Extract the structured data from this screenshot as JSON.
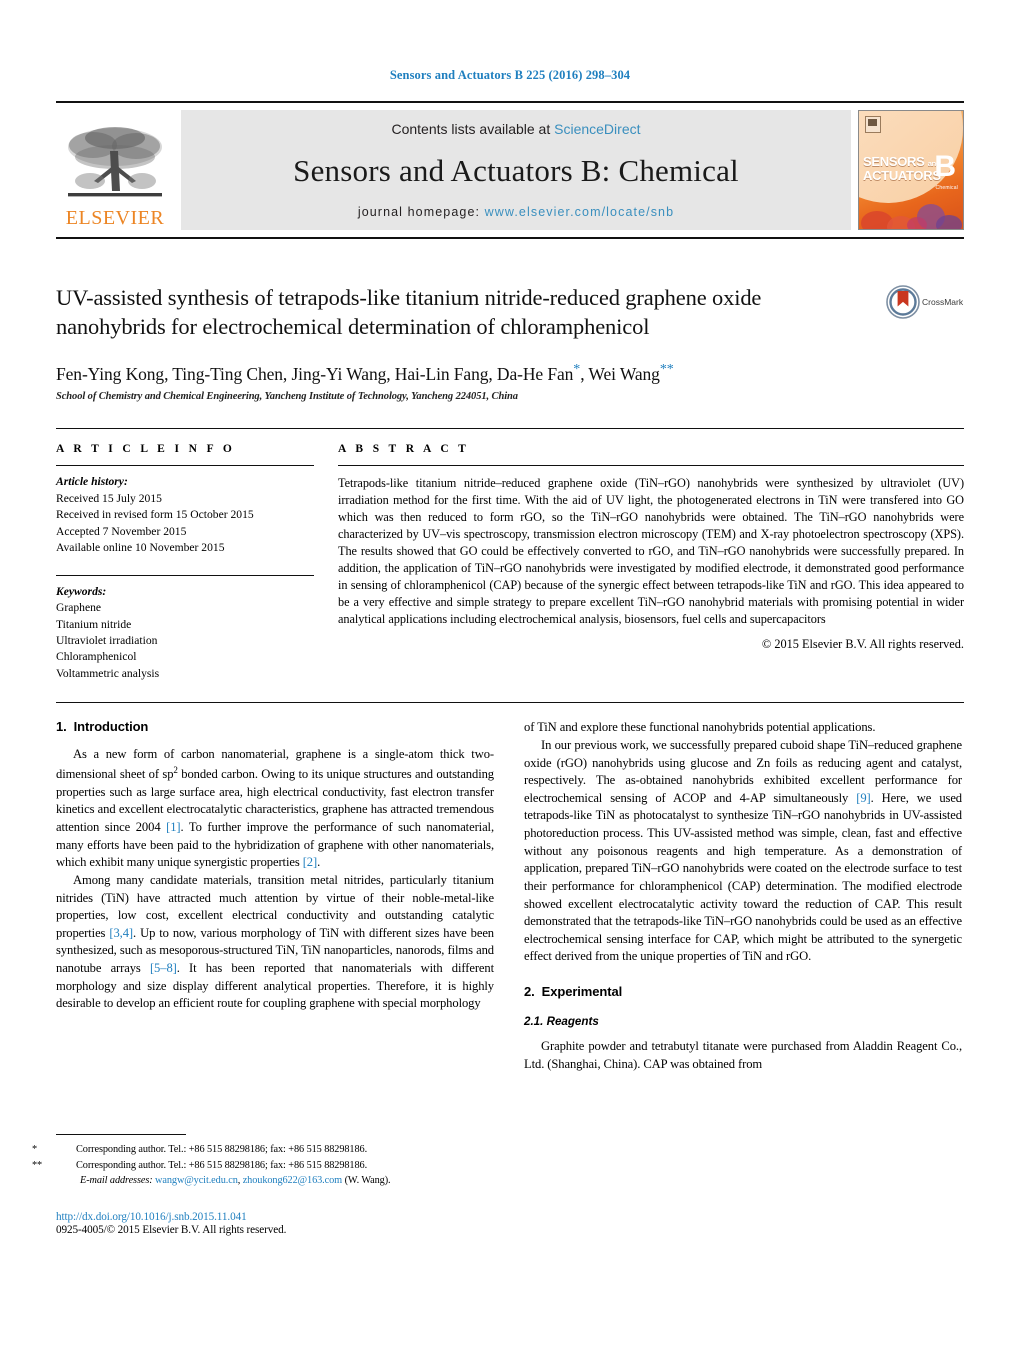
{
  "running_head": "Sensors and Actuators B 225 (2016) 298–304",
  "masthead": {
    "publisher_wordmark": "ELSEVIER",
    "contents_prefix": "Contents lists available at ",
    "contents_link": "ScienceDirect",
    "journal_title": "Sensors and Actuators B: Chemical",
    "homepage_prefix": "journal homepage: ",
    "homepage_url": "www.elsevier.com/locate/snb",
    "cover": {
      "line1": "SENSORS",
      "line1_and": "and",
      "line2": "ACTUATORS",
      "letter": "B",
      "letter_sub": "Chemical"
    }
  },
  "article": {
    "title": "UV-assisted synthesis of tetrapods-like titanium nitride-reduced graphene oxide nanohybrids for electrochemical determination of chloramphenicol",
    "crossmark_label": "CrossMark",
    "authors": "Fen-Ying Kong, Ting-Ting Chen, Jing-Yi Wang, Hai-Lin Fang, Da-He Fan",
    "authors_tail": ", Wei Wang",
    "star1": "*",
    "star2": "**",
    "affiliation": "School of Chemistry and Chemical Engineering, Yancheng Institute of Technology, Yancheng 224051, China"
  },
  "article_info": {
    "heading": "A R T I C L E   I N F O",
    "history_label": "Article history:",
    "history": [
      "Received 15 July 2015",
      "Received in revised form 15 October 2015",
      "Accepted 7 November 2015",
      "Available online 10 November 2015"
    ],
    "keywords_label": "Keywords:",
    "keywords": [
      "Graphene",
      "Titanium nitride",
      "Ultraviolet irradiation",
      "Chloramphenicol",
      "Voltammetric analysis"
    ]
  },
  "abstract": {
    "heading": "A B S T R A C T",
    "text": "Tetrapods-like titanium nitride–reduced graphene oxide (TiN–rGO) nanohybrids were synthesized by ultraviolet (UV) irradiation method for the first time. With the aid of UV light, the photogenerated electrons in TiN were transfered into GO which was then reduced to form rGO, so the TiN–rGO nanohybrids were obtained. The TiN–rGO nanohybrids were characterized by UV–vis spectroscopy, transmission electron microscopy (TEM) and X-ray photoelectron spectroscopy (XPS). The results showed that GO could be effectively converted to rGO, and TiN–rGO nanohybrids were successfully prepared. In addition, the application of TiN–rGO nanohybrids were investigated by modified electrode, it demonstrated good performance in sensing of chloramphenicol (CAP) because of the synergic effect between tetrapods-like TiN and rGO. This idea appeared to be a very effective and simple strategy to prepare excellent TiN–rGO nanohybrid materials with promising potential in wider analytical applications including electrochemical analysis, biosensors, fuel cells and supercapacitors",
    "copyright": "© 2015 Elsevier B.V. All rights reserved."
  },
  "sections": {
    "intro_number": "1.",
    "intro_title": "Introduction",
    "experimental_number": "2.",
    "experimental_title": "Experimental",
    "reagents_number": "2.1.",
    "reagents_title": "Reagents"
  },
  "body": {
    "left_p1_a": "As a new form of carbon nanomaterial, graphene is a single-atom thick two-dimensional sheet of sp",
    "left_p1_sup": "2",
    "left_p1_b": " bonded carbon. Owing to its unique structures and outstanding properties such as large surface area, high electrical conductivity, fast electron transfer kinetics and excellent electrocatalytic characteristics, graphene has attracted tremendous attention since 2004 ",
    "left_p1_ref1": "[1]",
    "left_p1_c": ". To further improve the performance of such nanomaterial, many efforts have been paid to the hybridization of graphene with other nanomaterials, which exhibit many unique synergistic properties ",
    "left_p1_ref2": "[2]",
    "left_p1_d": ".",
    "left_p2_a": "Among many candidate materials, transition metal nitrides, particularly titanium nitrides (TiN) have attracted much attention by virtue of their noble-metal-like properties, low cost, excellent electrical conductivity and outstanding catalytic properties ",
    "left_p2_ref1": "[3,4]",
    "left_p2_b": ". Up to now, various morphology of TiN with different sizes have been synthesized, such as mesoporous-structured TiN, TiN nanoparticles, nanorods, films and nanotube arrays ",
    "left_p2_ref2": "[5–8]",
    "left_p2_c": ". It has been reported that nanomaterials with different morphology and size display different analytical properties. Therefore, it is highly desirable to develop an efficient route for coupling graphene with special morphology",
    "right_p0": "of TiN and explore these functional nanohybrids potential applications.",
    "right_p1_a": "In our previous work, we successfully prepared cuboid shape TiN–reduced graphene oxide (rGO) nanohybrids using glucose and Zn foils as reducing agent and catalyst, respectively. The as-obtained nanohybrids exhibited excellent performance for electrochemical sensing of ACOP and 4-AP simultaneously ",
    "right_p1_ref": "[9]",
    "right_p1_b": ". Here, we used tetrapods-like TiN as photocatalyst to synthesize TiN–rGO nanohybrids in UV-assisted photoreduction process. This UV-assisted method was simple, clean, fast and effective without any poisonous reagents and high temperature. As a demonstration of application, prepared TiN–rGO nanohybrids were coated on the electrode surface to test their performance for chloramphenicol (CAP) determination. The modified electrode showed excellent electrocatalytic activity toward the reduction of CAP. This result demonstrated that the tetrapods-like TiN–rGO nanohybrids could be used as an effective electrochemical sensing interface for CAP, which might be attributed to the synergetic effect derived from the unique properties of TiN and rGO.",
    "reagents_p1": "Graphite powder and tetrabutyl titanate were purchased from Aladdin Reagent Co., Ltd. (Shanghai, China). CAP was obtained from"
  },
  "footnotes": {
    "fn1_mark": "*",
    "fn1_text": "Corresponding author. Tel.: +86 515 88298186; fax: +86 515 88298186.",
    "fn2_mark": "**",
    "fn2_text": "Corresponding author. Tel.: +86 515 88298186; fax: +86 515 88298186.",
    "email_label": "E-mail addresses:",
    "email1": "wangw@ycit.edu.cn",
    "email_sep": ", ",
    "email2": "zhoukong622@163.com",
    "email_tail": " (W. Wang).",
    "doi": "http://dx.doi.org/10.1016/j.snb.2015.11.041",
    "issn": "0925-4005/© 2015 Elsevier B.V. All rights reserved."
  },
  "colors": {
    "link": "#1f7fbf",
    "elsevier_orange": "#ec8524",
    "band_gray": "#e6e6e6"
  }
}
